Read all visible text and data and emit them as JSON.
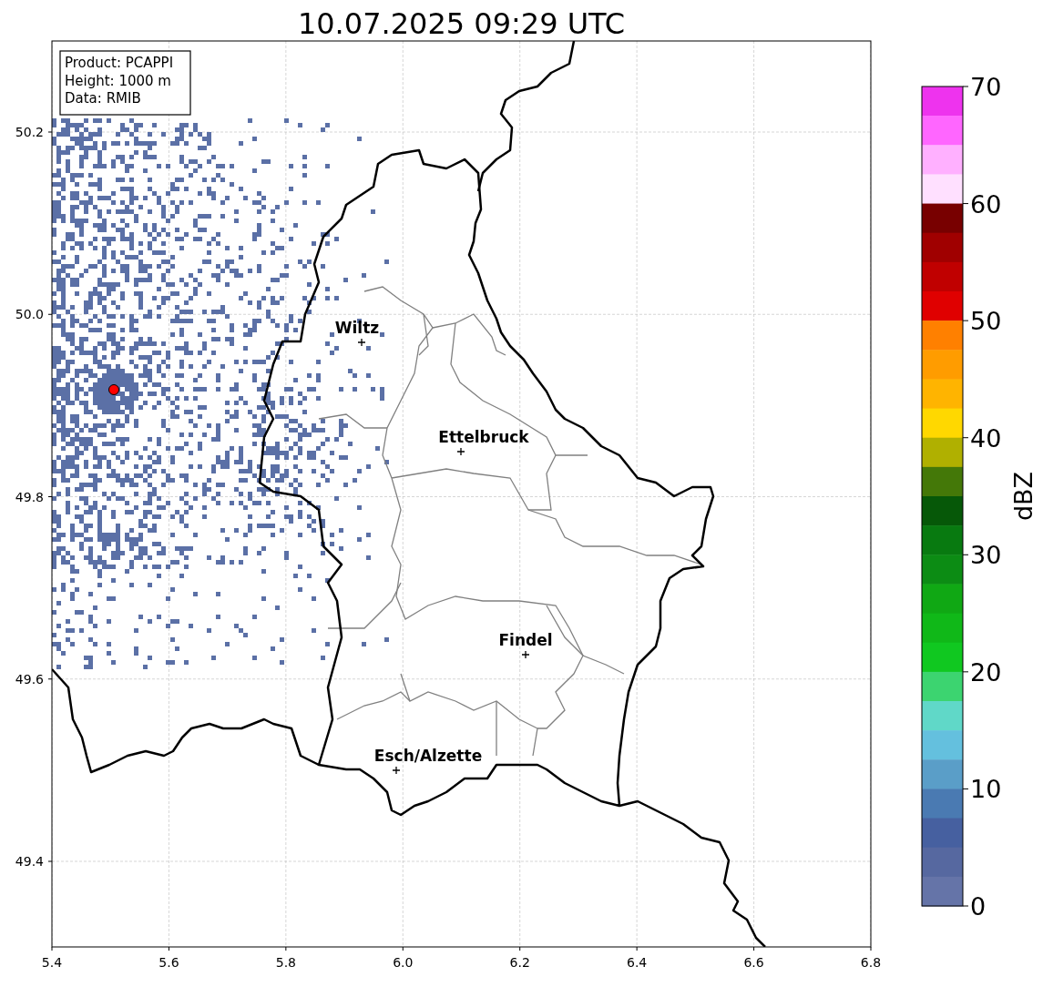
{
  "title": "10.07.2025 09:29 UTC",
  "info_box": [
    "Product: PCAPPI",
    "Height: 1000 m",
    "Data: RMIB"
  ],
  "x_ticks": [
    "5.4",
    "5.6",
    "5.8",
    "6.0",
    "6.2",
    "6.4",
    "6.6",
    "6.8"
  ],
  "y_ticks": [
    "50.2",
    "50.0",
    "49.8",
    "49.6",
    "49.4"
  ],
  "cities": [
    {
      "name": "Wiltz"
    },
    {
      "name": "Ettelbruck"
    },
    {
      "name": "Findel"
    },
    {
      "name": "Esch/Alzette"
    }
  ],
  "colorbar": {
    "label": "dBZ",
    "ticks": [
      "70",
      "60",
      "50",
      "40",
      "30",
      "20",
      "10",
      "0"
    ],
    "bands": [
      {
        "color": "#ee33ee"
      },
      {
        "color": "#ff66ff"
      },
      {
        "color": "#ffb0ff"
      },
      {
        "color": "#ffe0ff"
      },
      {
        "color": "#780000"
      },
      {
        "color": "#a00000"
      },
      {
        "color": "#c00000"
      },
      {
        "color": "#e00000"
      },
      {
        "color": "#ff8000"
      },
      {
        "color": "#ff9c00"
      },
      {
        "color": "#ffb400"
      },
      {
        "color": "#ffd800"
      },
      {
        "color": "#b0b000"
      },
      {
        "color": "#447808"
      },
      {
        "color": "#065808"
      },
      {
        "color": "#087a10"
      },
      {
        "color": "#0c8c14"
      },
      {
        "color": "#10a814"
      },
      {
        "color": "#10b818"
      },
      {
        "color": "#10c820"
      },
      {
        "color": "#3cd470"
      },
      {
        "color": "#60d8c8"
      },
      {
        "color": "#64c0de"
      },
      {
        "color": "#5a9ec8"
      },
      {
        "color": "#4a7ab2"
      },
      {
        "color": "#4660a0"
      },
      {
        "color": "#5668a0"
      },
      {
        "color": "#6574a8"
      }
    ]
  }
}
